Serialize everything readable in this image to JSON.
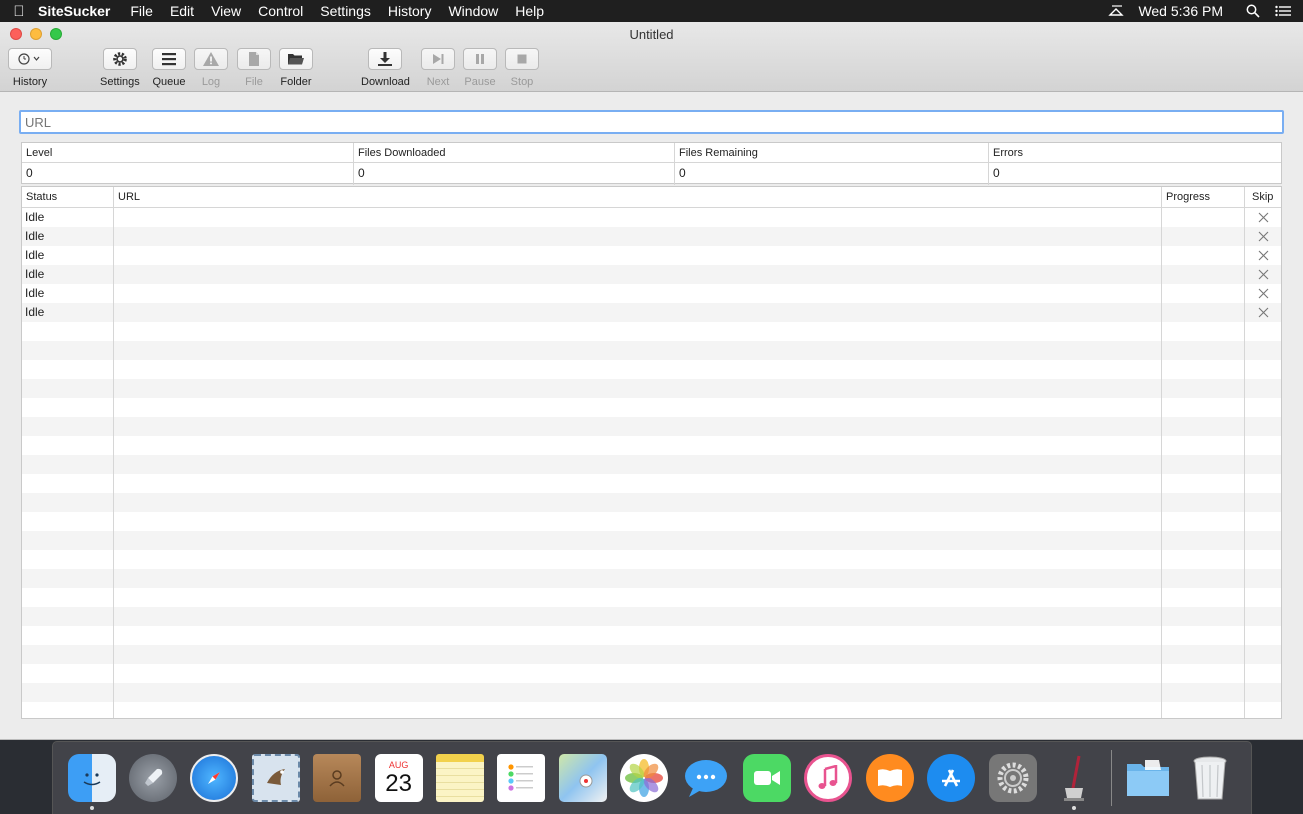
{
  "menubar": {
    "app_name": "SiteSucker",
    "items": [
      "File",
      "Edit",
      "View",
      "Control",
      "Settings",
      "History",
      "Window",
      "Help"
    ],
    "clock": "Wed 5:36 PM"
  },
  "window": {
    "title": "Untitled"
  },
  "toolbar": {
    "history": "History",
    "settings": "Settings",
    "queue": "Queue",
    "log": "Log",
    "file": "File",
    "folder": "Folder",
    "download": "Download",
    "next": "Next",
    "pause": "Pause",
    "stop": "Stop"
  },
  "url_field": {
    "placeholder": "URL",
    "value": ""
  },
  "stats": {
    "headers": [
      "Level",
      "Files Downloaded",
      "Files Remaining",
      "Errors"
    ],
    "values": [
      "0",
      "0",
      "0",
      "0"
    ]
  },
  "table": {
    "columns": [
      "Status",
      "URL",
      "Progress",
      "Skip"
    ],
    "rows": [
      {
        "status": "Idle",
        "url": "",
        "progress": ""
      },
      {
        "status": "Idle",
        "url": "",
        "progress": ""
      },
      {
        "status": "Idle",
        "url": "",
        "progress": ""
      },
      {
        "status": "Idle",
        "url": "",
        "progress": ""
      },
      {
        "status": "Idle",
        "url": "",
        "progress": ""
      },
      {
        "status": "Idle",
        "url": "",
        "progress": ""
      }
    ]
  },
  "dock": {
    "calendar_month": "AUG",
    "calendar_day": "23",
    "items": [
      "finder-icon",
      "launchpad-icon",
      "safari-icon",
      "mail-icon",
      "contacts-icon",
      "calendar-icon",
      "notes-icon",
      "reminders-icon",
      "maps-icon",
      "photos-icon",
      "messages-icon",
      "facetime-icon",
      "itunes-icon",
      "ibooks-icon",
      "app-store-icon",
      "system-preferences-icon",
      "sitesucker-icon",
      "folder-icon",
      "trash-icon"
    ]
  },
  "colors": {
    "accent": "#79aef2",
    "close": "#fc605b",
    "minimize": "#fdbc40",
    "maximize": "#34c84a"
  }
}
